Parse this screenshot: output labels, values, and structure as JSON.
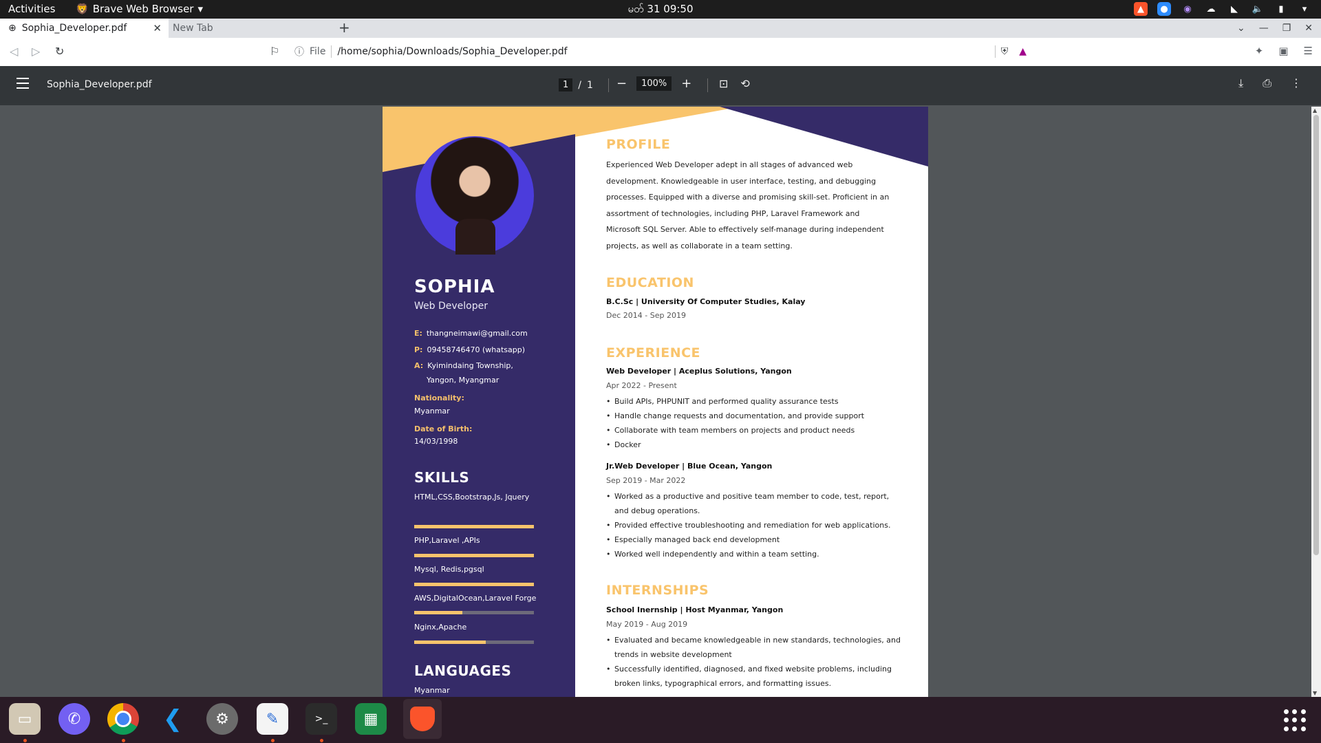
{
  "topbar": {
    "activities": "Activities",
    "app_name": "Brave Web Browser",
    "clock": "မတ် 31  09:50"
  },
  "tabs": [
    {
      "title": "Sophia_Developer.pdf"
    },
    {
      "title": "New Tab"
    }
  ],
  "toolbar": {
    "scheme": "File",
    "url": "/home/sophia/Downloads/Sophia_Developer.pdf"
  },
  "pdf": {
    "filename": "Sophia_Developer.pdf",
    "page_current": "1",
    "page_total": "1",
    "zoom": "100%"
  },
  "resume": {
    "name": "SOPHIA",
    "role": "Web Developer",
    "email_key": "E:",
    "email": "thangneimawi@gmail.com",
    "phone_key": "P:",
    "phone": "09458746470 (whatsapp)",
    "addr_key": "A:",
    "addr_line1": "Kyimindaing Township,",
    "addr_line2": "Yangon, Myangmar",
    "nationality_label": "Nationality:",
    "nationality": "Myanmar",
    "dob_label": "Date of Birth:",
    "dob": "14/03/1998",
    "skills_heading": "SKILLS",
    "skills": [
      {
        "label": "HTML,CSS,Bootstrap,Js, Jquery",
        "level": 1.0
      },
      {
        "label": "PHP,Laravel ,APIs",
        "level": 1.0
      },
      {
        "label": "Mysql, Redis,pgsql",
        "level": 1.0
      },
      {
        "label": "AWS,DigitalOcean,Laravel Forge",
        "level": 0.4
      },
      {
        "label": "Nginx,Apache",
        "level": 0.6
      }
    ],
    "languages_heading": "LANGUAGES",
    "languages": [
      "Myanmar"
    ],
    "profile_heading": "PROFILE",
    "profile_text": "Experienced Web Developer adept in all stages of advanced web development. Knowledgeable in user interface, testing, and debugging processes. Equipped with a diverse and promising skill-set. Proficient in an assortment of technologies, including PHP, Laravel Framework and Microsoft SQL Server. Able to effectively self-manage during independent projects, as well as collaborate in a team setting.",
    "education_heading": "EDUCATION",
    "education": {
      "title": "B.C.Sc | University Of Computer Studies, Kalay",
      "date": "Dec 2014 - Sep 2019"
    },
    "experience_heading": "EXPERIENCE",
    "experience": [
      {
        "title": "Web Developer | Aceplus Solutions, Yangon",
        "date": "Apr 2022 - Present",
        "bullets": [
          "Build APIs, PHPUNIT  and performed quality assurance tests",
          "Handle change requests and documentation, and provide support",
          "Collaborate with team members on projects and product needs",
          "Docker"
        ]
      },
      {
        "title": "Jr.Web Developer | Blue Ocean, Yangon",
        "date": "Sep 2019 - Mar 2022",
        "bullets": [
          "Worked as a productive and positive team member to code, test, report, and debug operations.",
          "Provided effective troubleshooting and remediation for web applications.",
          "Especially managed back end development",
          "Worked well independently and within a team setting."
        ]
      }
    ],
    "internships_heading": "INTERNSHIPS",
    "internship": {
      "title": "School Inernship | Host Myanmar, Yangon",
      "date": "May 2019 - Aug 2019",
      "bullets": [
        "Evaluated and became knowledgeable in new standards, technologies, and trends in website development",
        "Successfully identified, diagnosed, and fixed website problems, including broken links, typographical errors, and formatting issues."
      ]
    }
  },
  "colors": {
    "sidebar": "#352b68",
    "accent": "#f9c46c",
    "pdf_toolbar": "#323639",
    "viewer_bg": "#525659",
    "dock": "#2a1b26"
  },
  "dock_icons": [
    "files-icon",
    "viber-icon",
    "chrome-icon",
    "vscode-icon",
    "settings-icon",
    "text-editor-icon",
    "terminal-icon",
    "spreadsheet-icon",
    "brave-icon",
    "app-grid-icon"
  ]
}
